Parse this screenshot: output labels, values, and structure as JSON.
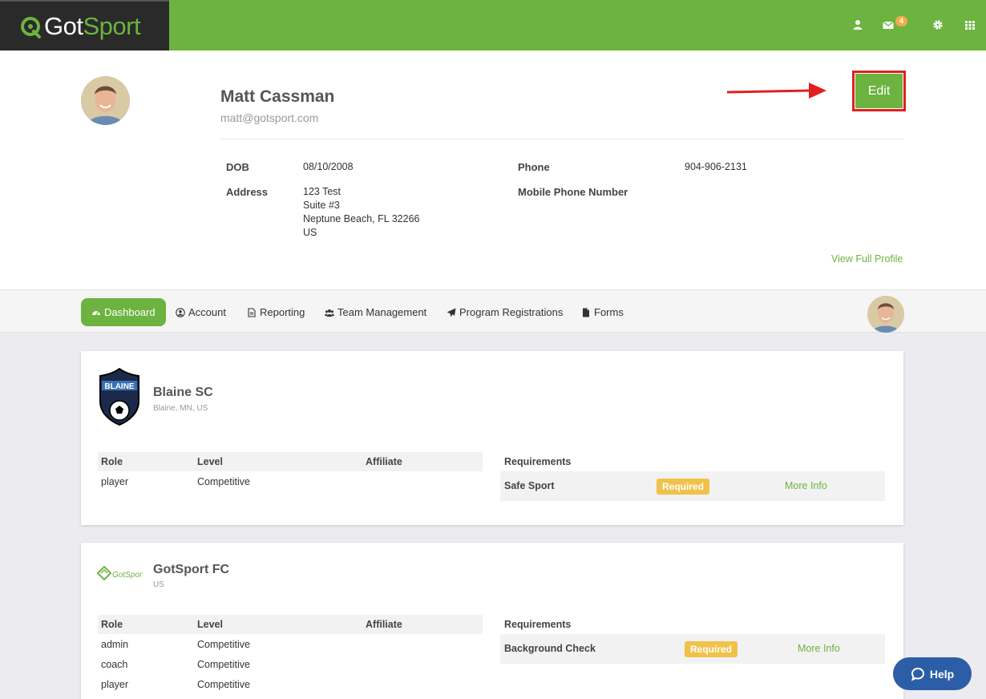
{
  "brand": {
    "part1": "Got",
    "part2": "Sport"
  },
  "header": {
    "mail_count": "4"
  },
  "profile": {
    "name": "Matt Cassman",
    "email": "matt@gotsport.com",
    "edit_label": "Edit",
    "dob_label": "DOB",
    "dob": "08/10/2008",
    "address_label": "Address",
    "address": [
      "123 Test",
      "Suite #3",
      "Neptune Beach, FL 32266",
      "US"
    ],
    "phone_label": "Phone",
    "phone": "904-906-2131",
    "mobile_label": "Mobile Phone Number",
    "view_full": "View Full Profile"
  },
  "nav": {
    "items": [
      {
        "label": "Dashboard",
        "icon": "dashboard-icon",
        "active": true
      },
      {
        "label": "Account",
        "icon": "user-circle-icon"
      },
      {
        "label": "Reporting",
        "icon": "document-icon"
      },
      {
        "label": "Team Management",
        "icon": "users-icon"
      },
      {
        "label": "Program Registrations",
        "icon": "paper-plane-icon"
      },
      {
        "label": "Forms",
        "icon": "file-icon"
      }
    ]
  },
  "clubs": [
    {
      "name": "Blaine SC",
      "location": "Blaine, MN, US",
      "headers": {
        "role": "Role",
        "level": "Level",
        "affiliate": "Affiliate",
        "requirements": "Requirements"
      },
      "rows": [
        {
          "role": "player",
          "level": "Competitive"
        }
      ],
      "requirement": {
        "name": "Safe Sport",
        "status": "Required",
        "link": "More Info"
      }
    },
    {
      "name": "GotSport FC",
      "location": "US",
      "logo_text": "GotSport",
      "headers": {
        "role": "Role",
        "level": "Level",
        "affiliate": "Affiliate",
        "requirements": "Requirements"
      },
      "rows": [
        {
          "role": "admin",
          "level": "Competitive"
        },
        {
          "role": "coach",
          "level": "Competitive"
        },
        {
          "role": "player",
          "level": "Competitive"
        }
      ],
      "requirement": {
        "name": "Background Check",
        "status": "Required",
        "link": "More Info"
      }
    }
  ],
  "help": {
    "label": "Help"
  },
  "colors": {
    "brand_green": "#6cb33f",
    "header_dark": "#2a2a2a",
    "badge_yellow": "#f0c24a",
    "help_blue": "#2b5ea7",
    "annotation_red": "#e02020"
  }
}
